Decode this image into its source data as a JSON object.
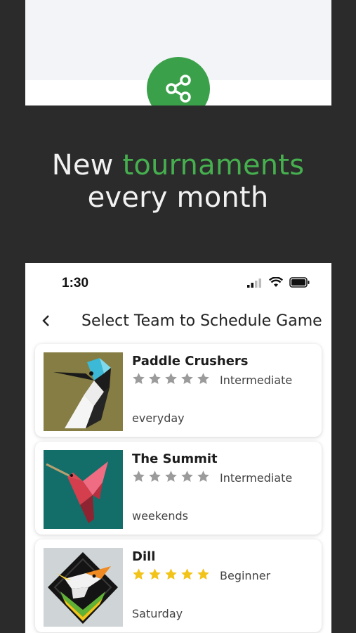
{
  "headline": {
    "line1_plain": "New ",
    "line1_accent": "tournaments",
    "line2": "every month"
  },
  "colors": {
    "accent": "#46b04f",
    "share_button": "#3aa14a",
    "star_filled": "#f2c318",
    "star_empty": "#9b9b9b"
  },
  "status_bar": {
    "time": "1:30"
  },
  "nav": {
    "title": "Select Team to Schedule Game"
  },
  "teams": [
    {
      "name": "Paddle Crushers",
      "rating": 0,
      "max_rating": 5,
      "level": "Intermediate",
      "schedule": "everyday",
      "icon": "kingfisher-avatar"
    },
    {
      "name": "The Summit",
      "rating": 0,
      "max_rating": 5,
      "level": "Intermediate",
      "schedule": "weekends",
      "icon": "hummingbird-avatar"
    },
    {
      "name": "Dill",
      "rating": 5,
      "max_rating": 5,
      "level": "Beginner",
      "schedule": "Saturday",
      "icon": "bird-diamond-avatar"
    }
  ]
}
